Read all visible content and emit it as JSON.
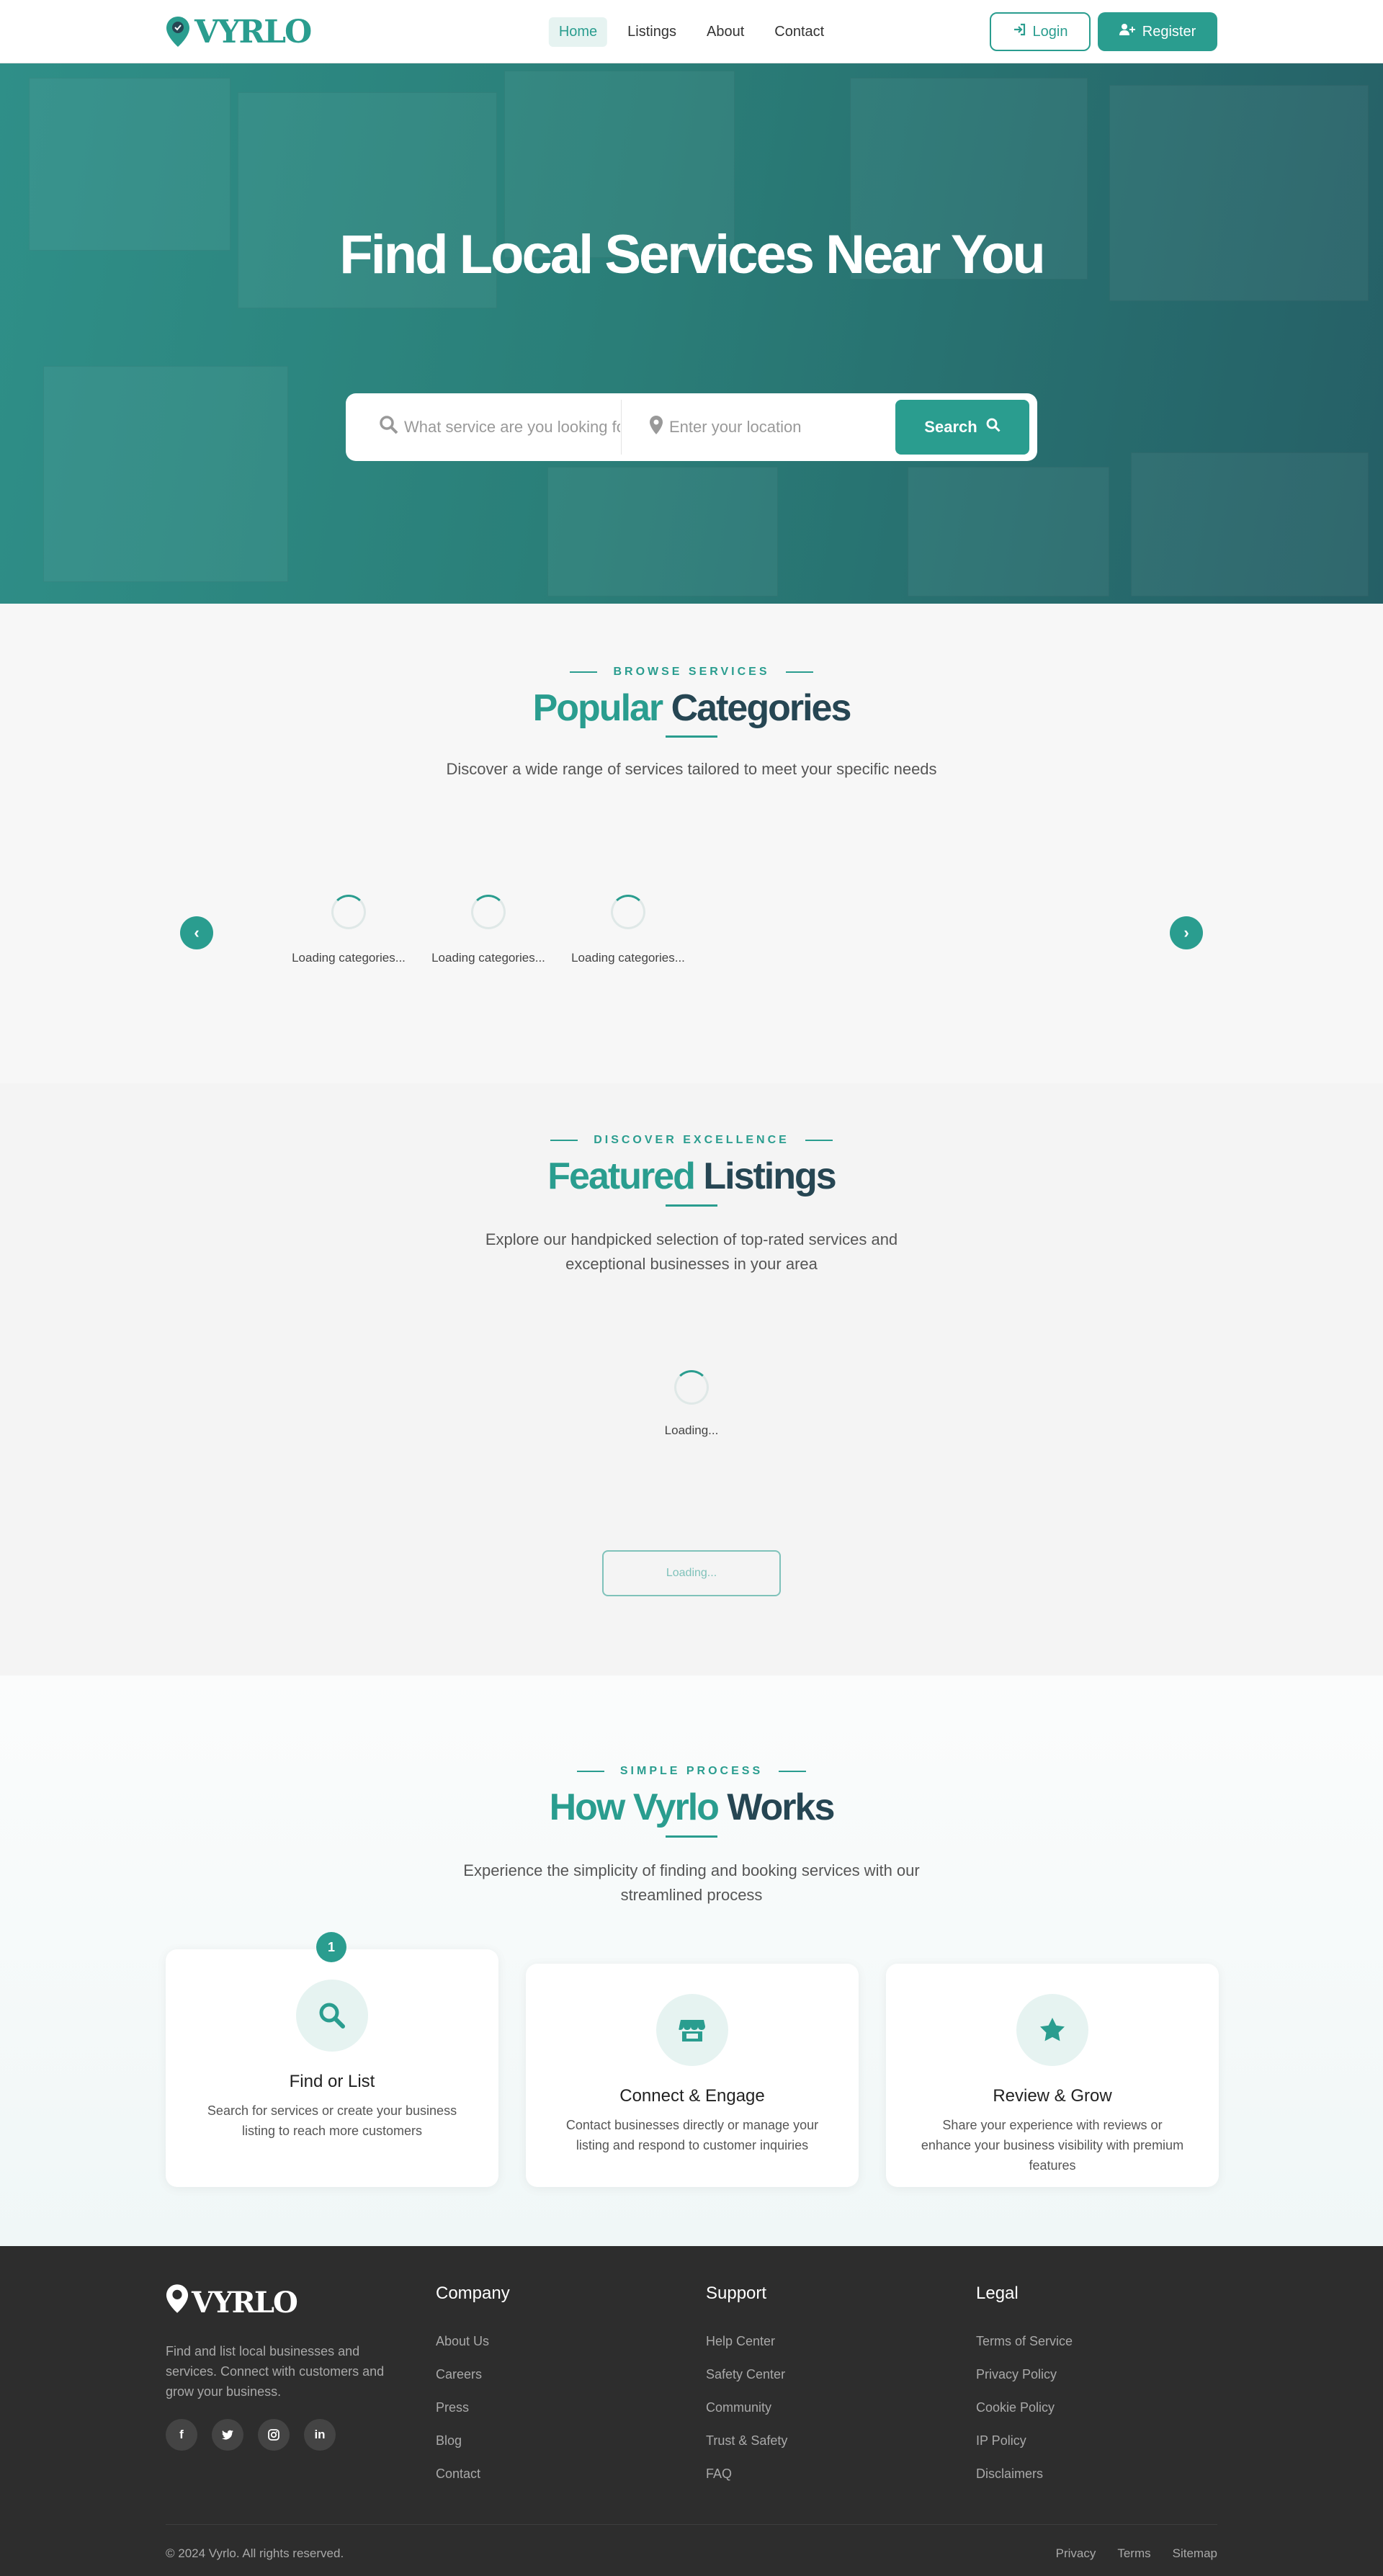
{
  "nav": {
    "logo_text": "VYRLO",
    "items": [
      {
        "label": "Home",
        "active": true
      },
      {
        "label": "Listings",
        "active": false
      },
      {
        "label": "About",
        "active": false
      },
      {
        "label": "Contact",
        "active": false
      }
    ],
    "login_label": "Login",
    "register_label": "Register"
  },
  "hero": {
    "title": "Find Local Services Near You",
    "service_placeholder": "What service are you looking for?",
    "location_placeholder": "Enter your location",
    "search_label": "Search"
  },
  "categories": {
    "eyebrow": "BROWSE SERVICES",
    "title_a": "Popular",
    "title_b": "Categories",
    "subtitle": "Discover a wide range of services tailored to meet your specific needs",
    "loading": [
      "Loading categories...",
      "Loading categories...",
      "Loading categories..."
    ]
  },
  "featured": {
    "eyebrow": "DISCOVER EXCELLENCE",
    "title_a": "Featured",
    "title_b": "Listings",
    "subtitle_1": "Explore our handpicked selection of top-rated services and",
    "subtitle_2": "exceptional businesses in your area",
    "loading": "Loading...",
    "button_label": "Loading..."
  },
  "how": {
    "eyebrow": "SIMPLE PROCESS",
    "title_a": "How Vyrlo",
    "title_b": "Works",
    "subtitle_1": "Experience the simplicity of finding and booking services with our",
    "subtitle_2": "streamlined process",
    "active_step": "1",
    "steps": [
      {
        "title": "Find or List",
        "text": "Search for services or create your business listing to reach more customers",
        "icon": "search-icon"
      },
      {
        "title": "Connect & Engage",
        "text": "Contact businesses directly or manage your listing and respond to customer inquiries",
        "icon": "store-icon"
      },
      {
        "title": "Review & Grow",
        "text": "Share your experience with reviews or enhance your business visibility with premium features",
        "icon": "star-icon"
      }
    ]
  },
  "footer": {
    "logo_text": "VYRLO",
    "description": "Find and list local businesses and services. Connect with customers and grow your business.",
    "social": [
      "facebook-icon",
      "twitter-icon",
      "instagram-icon",
      "linkedin-icon"
    ],
    "columns": [
      {
        "title": "Company",
        "links": [
          "About Us",
          "Careers",
          "Press",
          "Blog",
          "Contact"
        ]
      },
      {
        "title": "Support",
        "links": [
          "Help Center",
          "Safety Center",
          "Community",
          "Trust & Safety",
          "FAQ"
        ]
      },
      {
        "title": "Legal",
        "links": [
          "Terms of Service",
          "Privacy Policy",
          "Cookie Policy",
          "IP Policy",
          "Disclaimers"
        ]
      }
    ],
    "copyright": "© 2024 Vyrlo. All rights reserved.",
    "bottom_links": [
      "Privacy",
      "Terms",
      "Sitemap"
    ]
  },
  "colors": {
    "accent": "#2a9d8f",
    "dark_teal": "#264653",
    "footer_bg": "#2d2d2d"
  }
}
